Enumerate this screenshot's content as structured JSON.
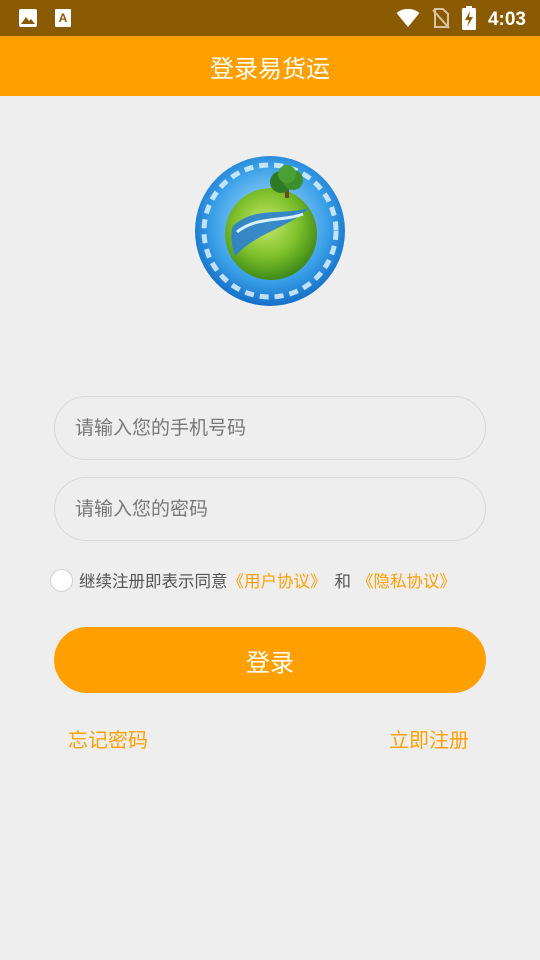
{
  "status_bar": {
    "time": "4:03",
    "left_icons": [
      "image-icon",
      "font-a-icon"
    ],
    "right_icons": [
      "wifi-icon",
      "no-sim-icon",
      "battery-charging-icon"
    ]
  },
  "app_bar": {
    "title": "登录易货运"
  },
  "logo": {
    "icon": "globe-tree-logo"
  },
  "form": {
    "phone_placeholder": "请输入您的手机号码",
    "password_placeholder": "请输入您的密码"
  },
  "agreement": {
    "prefix": "继续注册即表示同意",
    "user_agreement": "《用户协议》",
    "conjunction": "和",
    "privacy_policy": "《隐私协议》",
    "checked": false
  },
  "login_button": "登录",
  "links": {
    "forgot_password": "忘记密码",
    "register": "立即注册"
  },
  "colors": {
    "accent": "#ffa000",
    "status_bar": "#8a5a00",
    "background": "#eeeeee"
  }
}
